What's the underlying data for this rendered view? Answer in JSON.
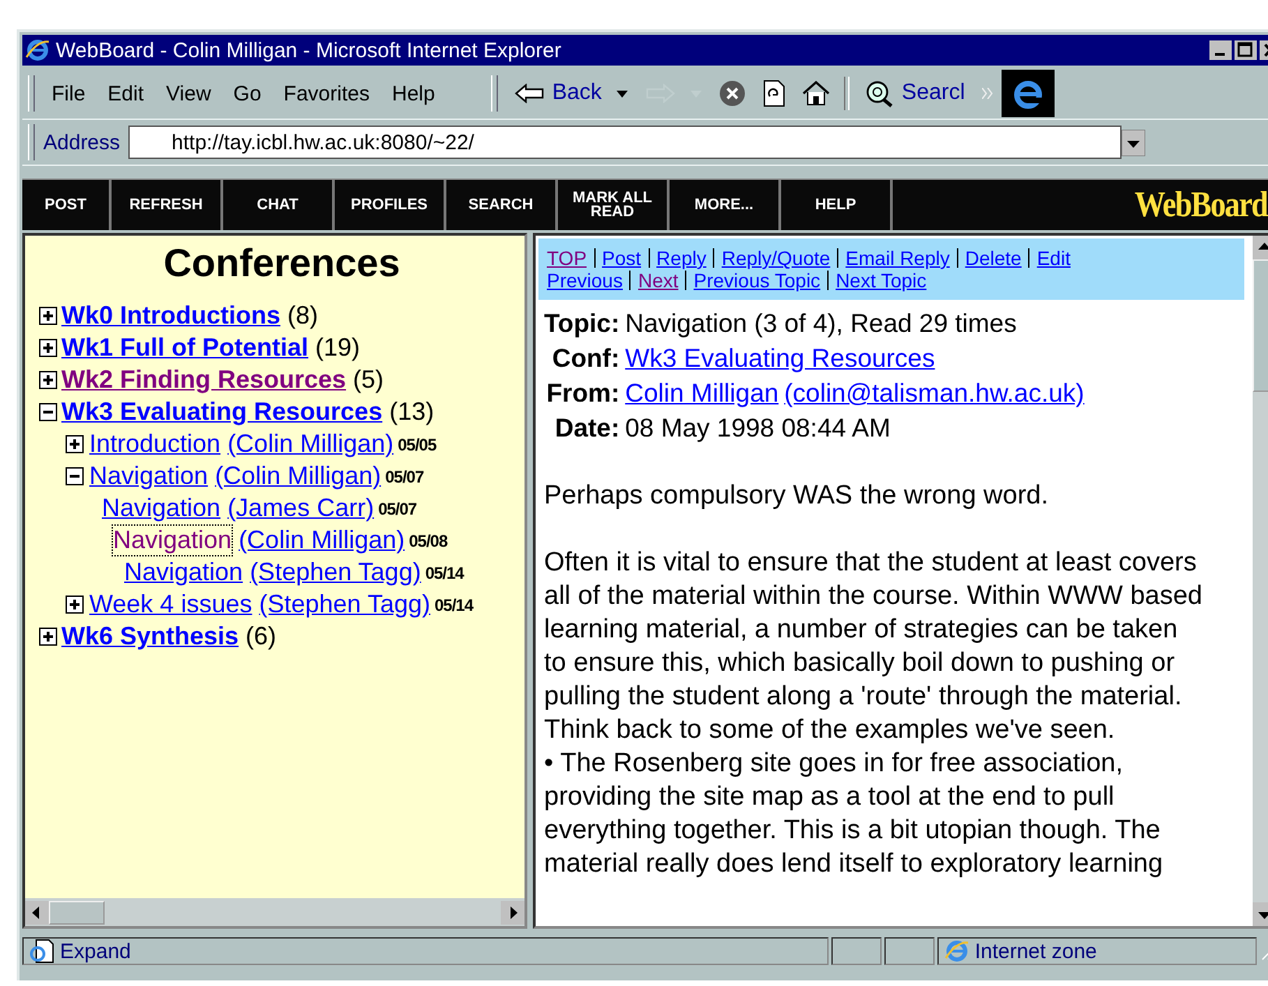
{
  "window": {
    "title": "WebBoard - Colin Milligan - Microsoft Internet Explorer"
  },
  "menu": [
    "File",
    "Edit",
    "View",
    "Go",
    "Favorites",
    "Help"
  ],
  "toolbar": [
    {
      "kind": "back",
      "label": "Back",
      "disabled": false
    },
    {
      "kind": "forward",
      "disabled": true
    },
    {
      "kind": "stop",
      "disabled": false
    },
    {
      "kind": "refresh",
      "disabled": false
    },
    {
      "kind": "home",
      "disabled": false
    },
    {
      "kind": "search",
      "label": "Searcl",
      "disabled": false
    }
  ],
  "address": {
    "label": "Address",
    "value": "http://tay.icbl.hw.ac.uk:8080/~22/"
  },
  "webboard_nav": {
    "buttons": [
      "POST",
      "REFRESH",
      "CHAT",
      "PROFILES",
      "SEARCH",
      "MARK ALL READ",
      "MORE...",
      "HELP"
    ],
    "logo": "WebBoard"
  },
  "conferences": {
    "heading": "Conferences",
    "items": [
      {
        "title": "Wk0 Introductions",
        "count": "(8)",
        "expanded": false,
        "visited": false
      },
      {
        "title": "Wk1 Full of Potential",
        "count": "(19)",
        "expanded": false,
        "visited": false
      },
      {
        "title": "Wk2 Finding Resources",
        "count": "(5)",
        "expanded": false,
        "visited": true
      },
      {
        "title": "Wk3 Evaluating Resources",
        "count": "(13)",
        "expanded": true,
        "visited": false,
        "children": [
          {
            "title": "Introduction",
            "author": "(Colin Milligan)",
            "date": "05/05",
            "expanded": false,
            "visited": false,
            "focused": false
          },
          {
            "title": "Navigation",
            "author": "(Colin Milligan)",
            "date": "05/07",
            "expanded": true,
            "visited": false,
            "focused": false,
            "children": [
              {
                "title": "Navigation",
                "author": "(James Carr)",
                "date": "05/07",
                "visited": false,
                "focused": false,
                "children": [
                  {
                    "title": "Navigation",
                    "author": "(Colin Milligan)",
                    "date": "05/08",
                    "visited": true,
                    "focused": true,
                    "children": [
                      {
                        "title": "Navigation",
                        "author": "(Stephen Tagg)",
                        "date": "05/14",
                        "visited": false,
                        "focused": false
                      }
                    ]
                  }
                ]
              }
            ]
          },
          {
            "title": "Week 4 issues",
            "author": "(Stephen Tagg)",
            "date": "05/14",
            "expanded": false,
            "visited": false,
            "focused": false
          }
        ]
      },
      {
        "title": "Wk6 Synthesis",
        "count": "(6)",
        "expanded": false,
        "visited": false
      }
    ]
  },
  "message": {
    "link_rows": [
      [
        {
          "label": "TOP",
          "visited": true
        },
        {
          "label": "Post",
          "visited": false
        },
        {
          "label": "Reply",
          "visited": false
        },
        {
          "label": "Reply/Quote",
          "visited": false
        },
        {
          "label": "Email Reply",
          "visited": false
        },
        {
          "label": "Delete",
          "visited": false
        },
        {
          "label": "Edit",
          "visited": false
        }
      ],
      [
        {
          "label": "Previous",
          "visited": false
        },
        {
          "label": "Next",
          "visited": true
        },
        {
          "label": "Previous Topic",
          "visited": false
        },
        {
          "label": "Next Topic",
          "visited": false
        }
      ]
    ],
    "fields": [
      {
        "label": "Topic:",
        "value": "Navigation (3 of 4), Read 29 times",
        "kind": "text"
      },
      {
        "label": "Conf:",
        "value": "Wk3 Evaluating Resources",
        "kind": "link"
      },
      {
        "label": "From:",
        "value": "Colin Milligan",
        "extra": "(colin@talisman.hw.ac.uk)",
        "kind": "link"
      },
      {
        "label": "Date:",
        "value": "08 May 1998 08:44 AM",
        "kind": "text"
      }
    ],
    "body": [
      "Perhaps compulsory WAS the wrong word.",
      "Often it is vital to ensure that the student at least covers all of the material within the course. Within WWW based learning material, a number of strategies can be taken to ensure this, which basically boil down to pushing or pulling the student along a 'route' through the material. Think back to some of the examples we've seen.",
      "• The Rosenberg site goes in for free association, providing the site map as a tool at the end to pull everything together. This is a bit utopian though. The material really does lend itself to exploratory learning"
    ]
  },
  "status_bar": {
    "text": "Expand",
    "zone": "Internet zone"
  }
}
